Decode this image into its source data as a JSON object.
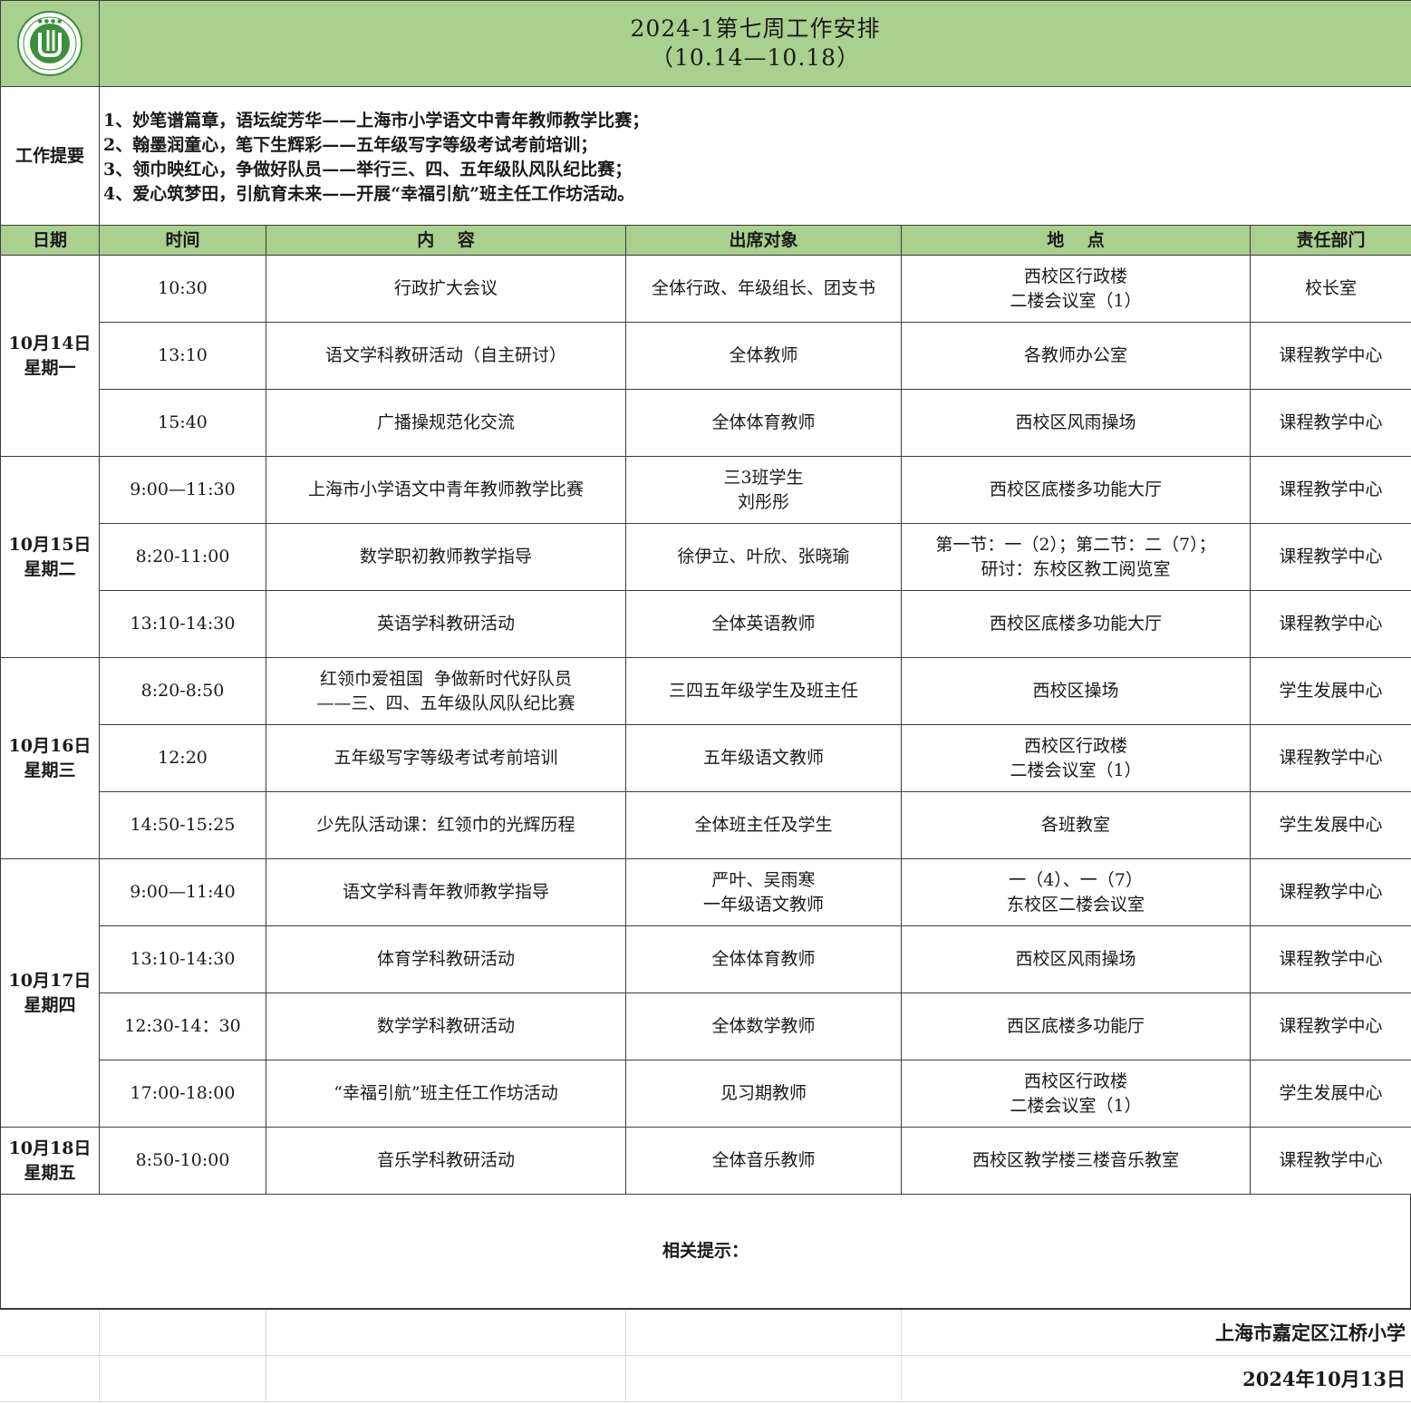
{
  "header": {
    "title": "2024-1第七周工作安排",
    "subtitle": "（10.14—10.18）",
    "logo_icon": "school-emblem-icon"
  },
  "summary": {
    "label": "工作提要",
    "items": [
      "1、妙笔谱篇章，语坛绽芳华——上海市小学语文中青年教师教学比赛；",
      "2、翰墨润童心，笔下生辉彩——五年级写字等级考试考前培训；",
      "3、领巾映红心，争做好队员——举行三、四、五年级队风队纪比赛；",
      "4、爱心筑梦田，引航育未来——开展“幸福引航”班主任工作坊活动。"
    ]
  },
  "columns": [
    "日期",
    "时间",
    "内　 容",
    "出席对象",
    "地　 点",
    "责任部门"
  ],
  "days": [
    {
      "date": "10月14日",
      "weekday": "星期一",
      "rows": [
        {
          "time": "10:30",
          "content": [
            "行政扩大会议"
          ],
          "attendees": [
            "全体行政、年级组长、团支书"
          ],
          "location": [
            "西校区行政楼",
            "二楼会议室（1）"
          ],
          "dept": "校长室"
        },
        {
          "time": "13:10",
          "content": [
            "语文学科教研活动（自主研讨）"
          ],
          "attendees": [
            "全体教师"
          ],
          "location": [
            "各教师办公室"
          ],
          "dept": "课程教学中心"
        },
        {
          "time": "15:40",
          "content": [
            "广播操规范化交流"
          ],
          "attendees": [
            "全体体育教师"
          ],
          "location": [
            "西校区风雨操场"
          ],
          "dept": "课程教学中心"
        }
      ]
    },
    {
      "date": "10月15日",
      "weekday": "星期二",
      "rows": [
        {
          "time": "9:00—11:30",
          "content": [
            "上海市小学语文中青年教师教学比赛"
          ],
          "attendees": [
            "三3班学生",
            "刘彤彤"
          ],
          "location": [
            "西校区底楼多功能大厅"
          ],
          "dept": "课程教学中心"
        },
        {
          "time": "8:20-11:00",
          "content": [
            "数学职初教师教学指导"
          ],
          "attendees": [
            "徐伊立、叶欣、张晓瑜"
          ],
          "location": [
            "第一节：一（2）；第二节：二（7）；",
            "研讨：东校区教工阅览室"
          ],
          "dept": "课程教学中心"
        },
        {
          "time": "13:10-14:30",
          "content": [
            "英语学科教研活动"
          ],
          "attendees": [
            "全体英语教师"
          ],
          "location": [
            "西校区底楼多功能大厅"
          ],
          "dept": "课程教学中心"
        }
      ]
    },
    {
      "date": "10月16日",
      "weekday": "星期三",
      "rows": [
        {
          "time": "8:20-8:50",
          "content": [
            "红领巾爱祖国  争做新时代好队员",
            "——三、四、五年级队风队纪比赛"
          ],
          "attendees": [
            "三四五年级学生及班主任"
          ],
          "location": [
            "西校区操场"
          ],
          "dept": "学生发展中心"
        },
        {
          "time": "12:20",
          "content": [
            "五年级写字等级考试考前培训"
          ],
          "attendees": [
            "五年级语文教师"
          ],
          "location": [
            "西校区行政楼",
            "二楼会议室（1）"
          ],
          "dept": "课程教学中心"
        },
        {
          "time": "14:50-15:25",
          "content": [
            "少先队活动课：红领巾的光辉历程"
          ],
          "attendees": [
            "全体班主任及学生"
          ],
          "location": [
            "各班教室"
          ],
          "dept": "学生发展中心"
        }
      ]
    },
    {
      "date": "10月17日",
      "weekday": "星期四",
      "rows": [
        {
          "time": "9:00—11:40",
          "content": [
            "语文学科青年教师教学指导"
          ],
          "attendees": [
            "严叶、吴雨寒",
            "一年级语文教师"
          ],
          "location": [
            "一（4）、一（7）",
            "东校区二楼会议室"
          ],
          "dept": "课程教学中心"
        },
        {
          "time": "13:10-14:30",
          "content": [
            "体育学科教研活动"
          ],
          "attendees": [
            "全体体育教师"
          ],
          "location": [
            "西校区风雨操场"
          ],
          "dept": "课程教学中心"
        },
        {
          "time": "12:30-14：30",
          "content": [
            "数学学科教研活动"
          ],
          "attendees": [
            "全体数学教师"
          ],
          "location": [
            "西区底楼多功能厅"
          ],
          "dept": "课程教学中心"
        },
        {
          "time": "17:00-18:00",
          "content": [
            "“幸福引航”班主任工作坊活动"
          ],
          "attendees": [
            "见习期教师"
          ],
          "location": [
            "西校区行政楼",
            "二楼会议室（1）"
          ],
          "dept": "学生发展中心"
        }
      ]
    },
    {
      "date": "10月18日",
      "weekday": "星期五",
      "rows": [
        {
          "time": "8:50-10:00",
          "content": [
            "音乐学科教研活动"
          ],
          "attendees": [
            "全体音乐教师"
          ],
          "location": [
            "西校区教学楼三楼音乐教室"
          ],
          "dept": "课程教学中心"
        }
      ]
    }
  ],
  "notes": {
    "label": "相关提示："
  },
  "footer": {
    "school": "上海市嘉定区江桥小学",
    "date": "2024年10月13日"
  },
  "colors": {
    "header_bg": "#a9d08e",
    "border": "#3c3c3c",
    "logo_green": "#3c8f3c"
  }
}
